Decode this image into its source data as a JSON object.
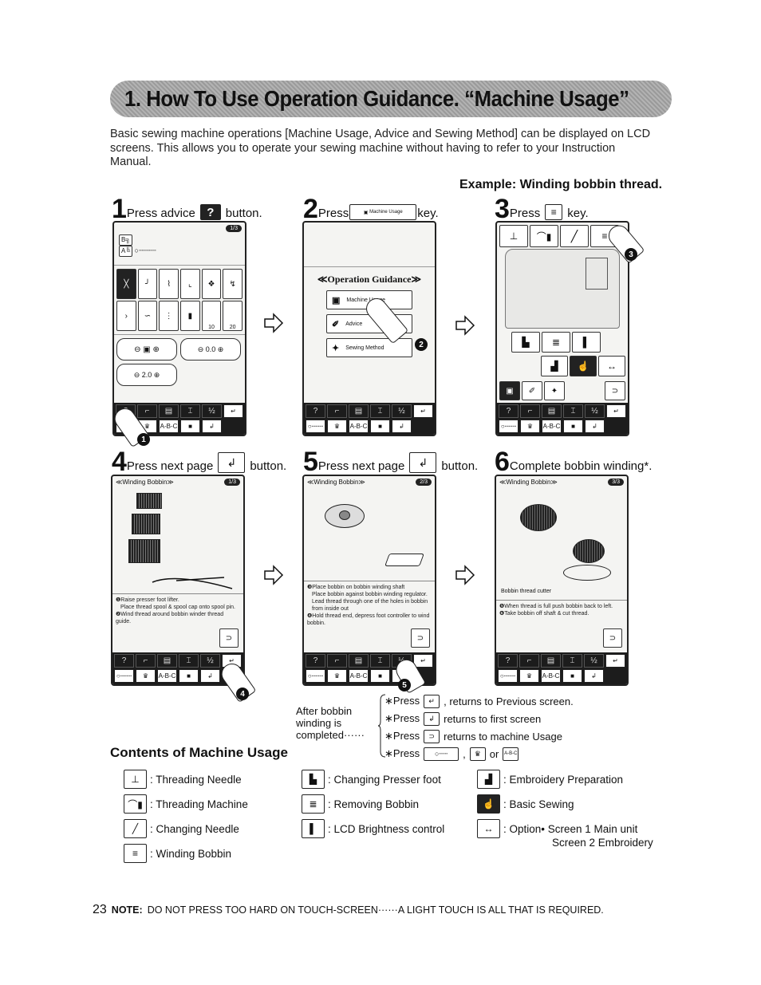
{
  "title": "1. How To Use Operation Guidance. “Machine Usage”",
  "intro": "Basic sewing machine operations [Machine Usage, Advice and Sewing Method] can be displayed on LCD screens. This allows you to operate your sewing machine without having to refer to your Instruction Manual.",
  "example_heading": "Example: Winding bobbin thread.",
  "steps": [
    {
      "num": "1",
      "pre": "Press advice",
      "key": "?",
      "post": "button."
    },
    {
      "num": "2",
      "pre": "Press",
      "key": "Machine Usage",
      "post": "key."
    },
    {
      "num": "3",
      "pre": "Press",
      "key": "winding-bobbin",
      "post": "key."
    },
    {
      "num": "4",
      "pre": "Press next page",
      "key": "next-page",
      "post": "button."
    },
    {
      "num": "5",
      "pre": "Press next page",
      "key": "next-page",
      "post": "button."
    },
    {
      "num": "6",
      "pre": "Complete bobbin winding*.",
      "key": "",
      "post": ""
    }
  ],
  "screen1": {
    "page": "1/3",
    "stitch_values": [
      "0.0",
      "2.0"
    ],
    "stitch_numbers": [
      "10",
      "20"
    ],
    "badge": "1"
  },
  "screen2": {
    "heading": "≪Operation Guidance≫",
    "buttons": [
      "Machine Usage",
      "Advice",
      "Sewing Method"
    ],
    "badge": "2"
  },
  "screen3": {
    "badge": "3"
  },
  "toolbar": {
    "top": [
      "?",
      "⌐",
      "▤",
      "⌶",
      "½",
      "↵"
    ],
    "bottom": [
      "○┄┄┄",
      "♛",
      "A-B-C",
      "■",
      "↲"
    ]
  },
  "screen4": {
    "title": "≪Winding Bobbin≫",
    "page": "1/3",
    "notes": [
      "❶Raise presser foot lifter.",
      "Place thread spool & spool cap onto spool pin.",
      "❷Wind thread around bobbin winder thread guide."
    ],
    "badge": "4"
  },
  "screen5": {
    "title": "≪Winding Bobbin≫",
    "page": "2/3",
    "notes": [
      "❸Place bobbin on bobbin winding shaft",
      "Place bobbin against bobbin winding regulator.",
      "Lead thread through one of the holes in bobbin from inside out",
      "❹Hold thread end, depress foot controller to wind bobbin."
    ],
    "badge": "5"
  },
  "screen6": {
    "title": "≪Winding Bobbin≫",
    "page": "3/3",
    "label": "Bobbin thread cutter",
    "notes": [
      "❺When thread is full push bobbin back to left.",
      "❻Take bobbin off shaft & cut thread."
    ]
  },
  "after": {
    "label": "After bobbin winding is completed······",
    "rows": [
      {
        "prefix": "∗Press",
        "icon": "↵",
        "text": ", returns to Previous screen."
      },
      {
        "prefix": "∗Press",
        "icon": "↲",
        "text": "returns to first screen"
      },
      {
        "prefix": "∗Press",
        "icon": "⊃",
        "text": "returns to machine Usage"
      },
      {
        "prefix": "∗Press",
        "icon": "○┄┄",
        "text": ",",
        "icon2": "♛",
        "or": "or",
        "icon3": "A-B-C"
      }
    ]
  },
  "contents": {
    "title": "Contents of Machine Usage",
    "col1": [
      {
        "icon": "⊥",
        "label": ": Threading Needle"
      },
      {
        "icon": "⌒▮",
        "label": ": Threading Machine"
      },
      {
        "icon": "╱",
        "label": ": Changing Needle"
      },
      {
        "icon": "≡",
        "label": ": Winding Bobbin"
      }
    ],
    "col2": [
      {
        "icon": "▙",
        "label": ": Changing Presser foot"
      },
      {
        "icon": "≣",
        "label": ": Removing Bobbin"
      },
      {
        "icon": "▌",
        "label": ": LCD Brightness control"
      }
    ],
    "col3": [
      {
        "icon": "▟",
        "label": ": Embroidery Preparation"
      },
      {
        "icon": "☝",
        "label": ": Basic Sewing"
      },
      {
        "icon": "↔",
        "label": ": Option• Screen 1 Main unit",
        "label2": "Screen 2 Embroidery"
      }
    ]
  },
  "footer": {
    "page": "23",
    "note_label": "NOTE:",
    "note": "DO NOT PRESS TOO HARD ON TOUCH-SCREEN······A LIGHT TOUCH IS ALL THAT IS REQUIRED."
  }
}
